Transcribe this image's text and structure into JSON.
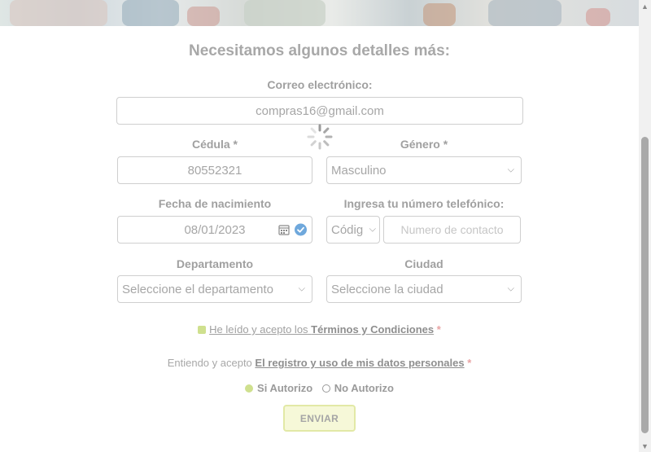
{
  "form": {
    "heading": "Necesitamos algunos detalles más:",
    "email": {
      "label": "Correo electrónico:",
      "value": "compras16@gmail.com"
    },
    "cedula": {
      "label": "Cédula *",
      "value": "80552321"
    },
    "genero": {
      "label": "Género *",
      "value": "Masculino"
    },
    "fecha": {
      "label": "Fecha de nacimiento",
      "value": "08/01/2023"
    },
    "telefono": {
      "label": "Ingresa tu número telefónico:",
      "code_value": "Códig",
      "placeholder": "Numero de contacto"
    },
    "departamento": {
      "label": "Departamento",
      "value": "Seleccione el departamento"
    },
    "ciudad": {
      "label": "Ciudad",
      "value": "Seleccione la ciudad"
    },
    "terms": {
      "prefix": "He leído y acepto los",
      "link": "Términos y Condiciones",
      "star": "*"
    },
    "consent": {
      "prefix": "Entiendo y acepto",
      "link": "El registro y uso de mis datos personales",
      "star": "*"
    },
    "radios": {
      "yes": "Si Autorizo",
      "no": "No Autorizo",
      "selected": "yes"
    },
    "submit": "ENVIAR"
  },
  "colors": {
    "accent": "#cfe08e",
    "required_star": "#e9a4a4",
    "text_muted": "#a0a0a0"
  },
  "icons": [
    "loading-spinner-icon",
    "calendar-icon",
    "check-circle-icon",
    "chevron-down-icon"
  ]
}
